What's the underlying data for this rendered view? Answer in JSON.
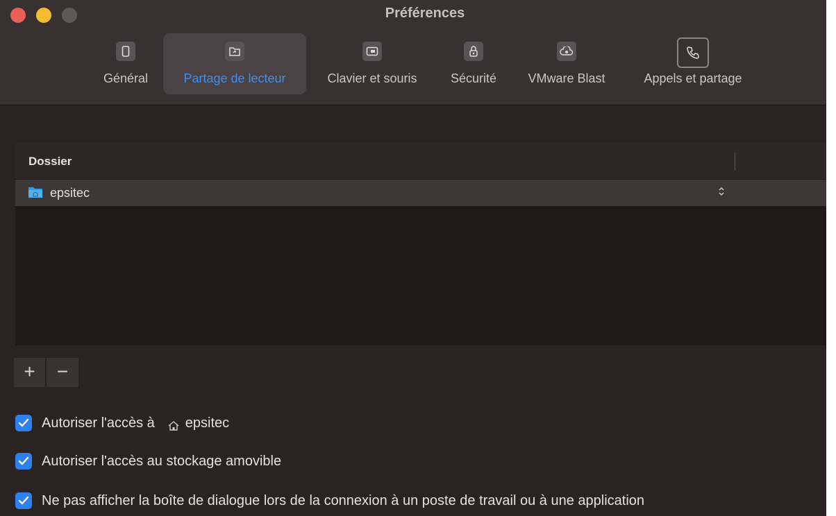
{
  "window": {
    "title": "Préférences"
  },
  "tabs": [
    {
      "label": "Général",
      "icon": "device-icon"
    },
    {
      "label": "Partage de lecteur",
      "icon": "folder-share-icon",
      "active": true
    },
    {
      "label": "Clavier et souris",
      "icon": "keyboard-icon"
    },
    {
      "label": "Sécurité",
      "icon": "lock-icon"
    },
    {
      "label": "VMware Blast",
      "icon": "cloud-eye-icon"
    },
    {
      "label": "Appels et partage",
      "icon": "phone-icon"
    }
  ],
  "folder_table": {
    "column_header": "Dossier",
    "rows": [
      {
        "name": "epsitec",
        "icon": "folder-icon"
      }
    ]
  },
  "buttons": {
    "add_label": "+",
    "remove_label": "−"
  },
  "options": [
    {
      "label": "Autoriser l'accès à",
      "extra": "epsitec",
      "checked": true
    },
    {
      "label": "Autoriser l'accès au stockage amovible",
      "checked": true
    },
    {
      "label": "Ne pas afficher la boîte de dialogue lors de la connexion à un poste de travail ou à une application",
      "checked": true
    }
  ],
  "colors": {
    "accent": "#3b8ff5",
    "checkbox": "#2e80ec",
    "close": "#ec5f56",
    "minimize": "#f3bd2f"
  }
}
